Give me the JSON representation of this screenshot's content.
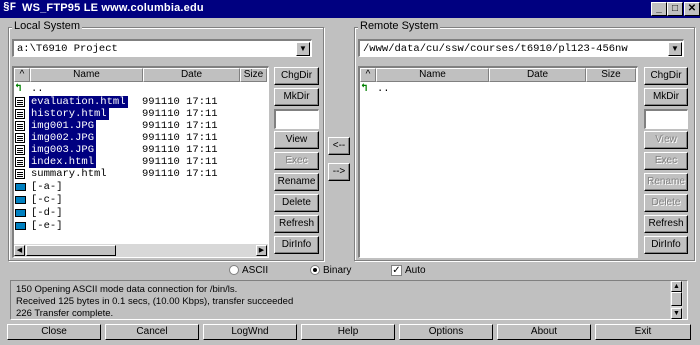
{
  "window": {
    "icon_text": "§F",
    "title": "WS_FTP95 LE www.columbia.edu",
    "min": "_",
    "max": "□",
    "close": "✕"
  },
  "local": {
    "legend": "Local System",
    "path": "a:\\T6910 Project",
    "headers": {
      "sort": "^",
      "name": "Name",
      "date": "Date",
      "size": "Size"
    },
    "up_label": "..",
    "files": [
      {
        "name": "evaluation.html",
        "date": "991110 17:11",
        "selected": true
      },
      {
        "name": "history.html",
        "date": "991110 17:11",
        "selected": true
      },
      {
        "name": "img001.JPG",
        "date": "991110 17:11",
        "selected": true
      },
      {
        "name": "img002.JPG",
        "date": "991110 17:11",
        "selected": true
      },
      {
        "name": "img003.JPG",
        "date": "991110 17:11",
        "selected": true
      },
      {
        "name": "index.html",
        "date": "991110 17:11",
        "selected": true
      },
      {
        "name": "summary.html",
        "date": "991110 17:11",
        "selected": false
      }
    ],
    "drives": [
      "[-a-]",
      "[-c-]",
      "[-d-]",
      "[-e-]"
    ],
    "buttons": {
      "chgdir": "ChgDir",
      "mkdir": "MkDir",
      "view": "View",
      "exec": "Exec",
      "rename": "Rename",
      "delete": "Delete",
      "refresh": "Refresh",
      "dirinfo": "DirInfo"
    }
  },
  "remote": {
    "legend": "Remote System",
    "path": "/www/data/cu/ssw/courses/t6910/pl123-456nw",
    "headers": {
      "sort": "^",
      "name": "Name",
      "date": "Date",
      "size": "Size"
    },
    "up_label": "..",
    "buttons": {
      "chgdir": "ChgDir",
      "mkdir": "MkDir",
      "view": "View",
      "exec": "Exec",
      "rename": "Rename",
      "delete": "Delete",
      "refresh": "Refresh",
      "dirinfo": "DirInfo"
    }
  },
  "transfer": {
    "left": "<--",
    "right": "-->"
  },
  "mode": {
    "ascii": "ASCII",
    "binary": "Binary",
    "auto": "Auto",
    "selected": "Binary",
    "auto_checked": true
  },
  "log": [
    "150 Opening ASCII mode data connection for /bin/ls.",
    "Received 125 bytes in 0.1 secs, (10.00 Kbps), transfer succeeded",
    "226 Transfer complete."
  ],
  "bottom_buttons": [
    "Close",
    "Cancel",
    "LogWnd",
    "Help",
    "Options",
    "About",
    "Exit"
  ]
}
